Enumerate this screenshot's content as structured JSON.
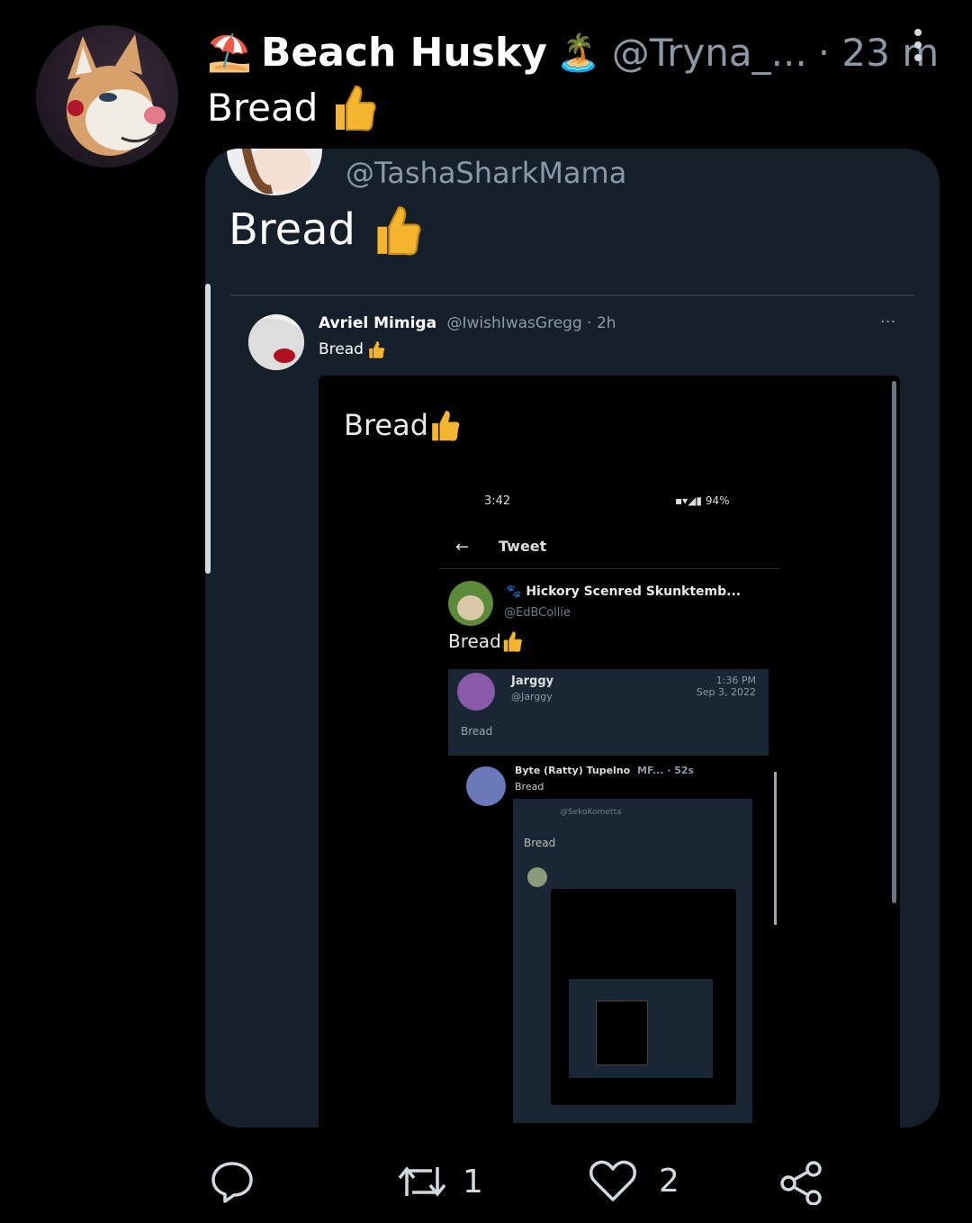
{
  "tweet": {
    "display_name": "Beach Husky",
    "name_emoji_left": "⛱️",
    "name_emoji_right": "🏝️",
    "handle": "@Tryna_...",
    "time": "· 23 m",
    "text": "Bread"
  },
  "quoted": {
    "handle": "@TashaSharkMama",
    "text": "Bread"
  },
  "nested": {
    "name": "Avriel Mimiga",
    "handle_time": "@IwishIwasGregg · 2h",
    "text": "Bread",
    "image_caption": "Bread"
  },
  "phone": {
    "time": "3:42",
    "status": "94%",
    "header": "Tweet",
    "author_name": "Hickory Scenred Skunktemb...",
    "author_handle": "@EdBCollie",
    "text": "Bread",
    "quote": {
      "name": "Jarggy",
      "handle": "@Jarggy",
      "time": "1:36 PM",
      "date": "Sep 3, 2022",
      "text": "Bread"
    },
    "reply": {
      "name": "Byte (Ratty) Tupelno",
      "suffix": "MF... · 52s",
      "text": "Bread",
      "inner_handle": "@SekoKometta",
      "inner_text": "Bread"
    }
  },
  "actions": {
    "retweet_count": "1",
    "like_count": "2"
  },
  "colors": {
    "background": "#000000",
    "card": "#15202b",
    "secondary_text": "#8b98a5",
    "thumb": "#f5b52e"
  }
}
